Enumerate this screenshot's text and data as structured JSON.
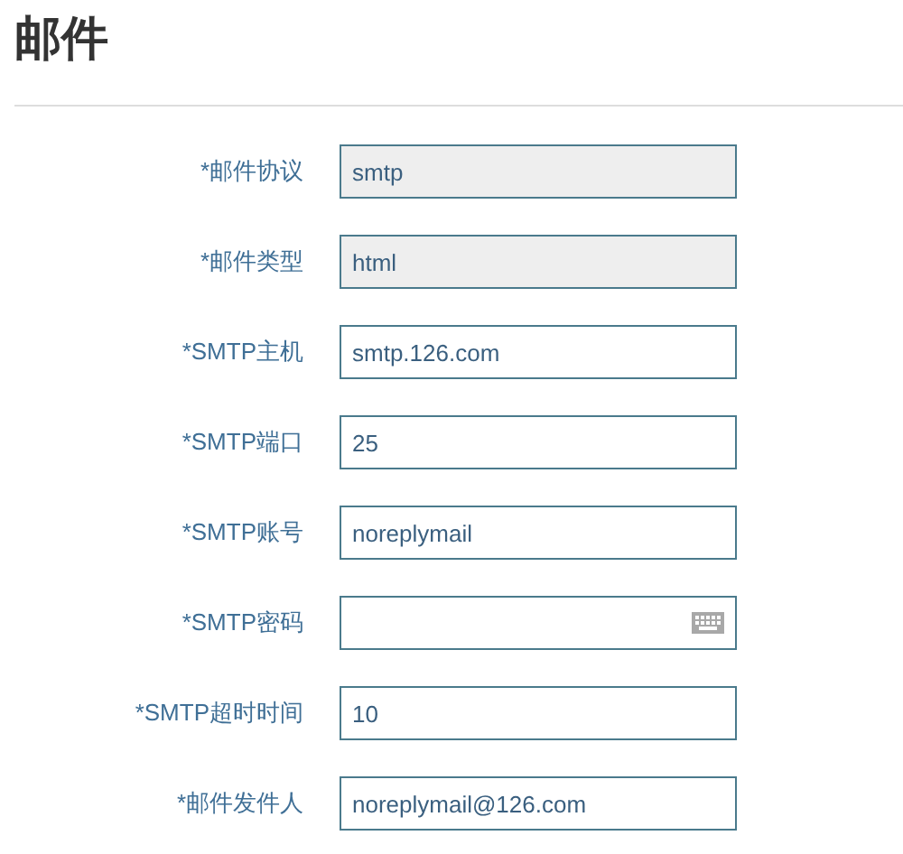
{
  "title": "邮件",
  "fields": [
    {
      "label": "*邮件协议",
      "kind": "text",
      "value": "smtp",
      "disabled": true
    },
    {
      "label": "*邮件类型",
      "kind": "text",
      "value": "html",
      "disabled": true
    },
    {
      "label": "*SMTP主机",
      "kind": "text",
      "value": "smtp.126.com",
      "disabled": false
    },
    {
      "label": "*SMTP端口",
      "kind": "text",
      "value": "25",
      "disabled": false
    },
    {
      "label": "*SMTP账号",
      "kind": "text",
      "value": "noreplymail",
      "disabled": false
    },
    {
      "label": "*SMTP密码",
      "kind": "password",
      "disabled": false
    },
    {
      "label": "*SMTP超时时间",
      "kind": "text",
      "value": "10",
      "disabled": false
    },
    {
      "label": "*邮件发件人",
      "kind": "text",
      "value": "noreplymail@126.com",
      "disabled": false
    }
  ]
}
